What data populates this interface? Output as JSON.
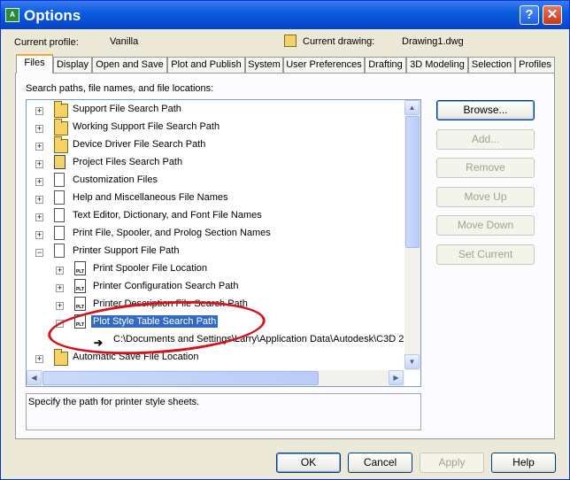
{
  "window": {
    "title": "Options",
    "help_button": "?",
    "close_button": "✕"
  },
  "header": {
    "profile_label": "Current profile:",
    "profile_value": "Vanilla",
    "drawing_label": "Current drawing:",
    "drawing_value": "Drawing1.dwg"
  },
  "tabs": [
    "Files",
    "Display",
    "Open and Save",
    "Plot and Publish",
    "System",
    "User Preferences",
    "Drafting",
    "3D Modeling",
    "Selection",
    "Profiles"
  ],
  "tree": {
    "heading": "Search paths, file names, and file locations:",
    "items": [
      {
        "label": "Support File Search Path"
      },
      {
        "label": "Working Support File Search Path"
      },
      {
        "label": "Device Driver File Search Path"
      },
      {
        "label": "Project Files Search Path"
      },
      {
        "label": "Customization Files"
      },
      {
        "label": "Help and Miscellaneous File Names"
      },
      {
        "label": "Text Editor, Dictionary, and Font File Names"
      },
      {
        "label": "Print File, Spooler, and Prolog Section Names"
      },
      {
        "label": "Printer Support File Path"
      },
      {
        "label": "Print Spooler File Location"
      },
      {
        "label": "Printer Configuration Search Path"
      },
      {
        "label": "Printer Description File Search Path"
      },
      {
        "label": "Plot Style Table Search Path"
      },
      {
        "label": "C:\\Documents and Settings\\Larry\\Application Data\\Autodesk\\C3D 2"
      },
      {
        "label": "Automatic Save File Location"
      }
    ]
  },
  "description": "Specify the path for printer style sheets.",
  "side_buttons": [
    "Browse...",
    "Add...",
    "Remove",
    "Move Up",
    "Move Down",
    "Set Current"
  ],
  "bottom_buttons": [
    "OK",
    "Cancel",
    "Apply",
    "Help"
  ],
  "icon_label": "PLT"
}
